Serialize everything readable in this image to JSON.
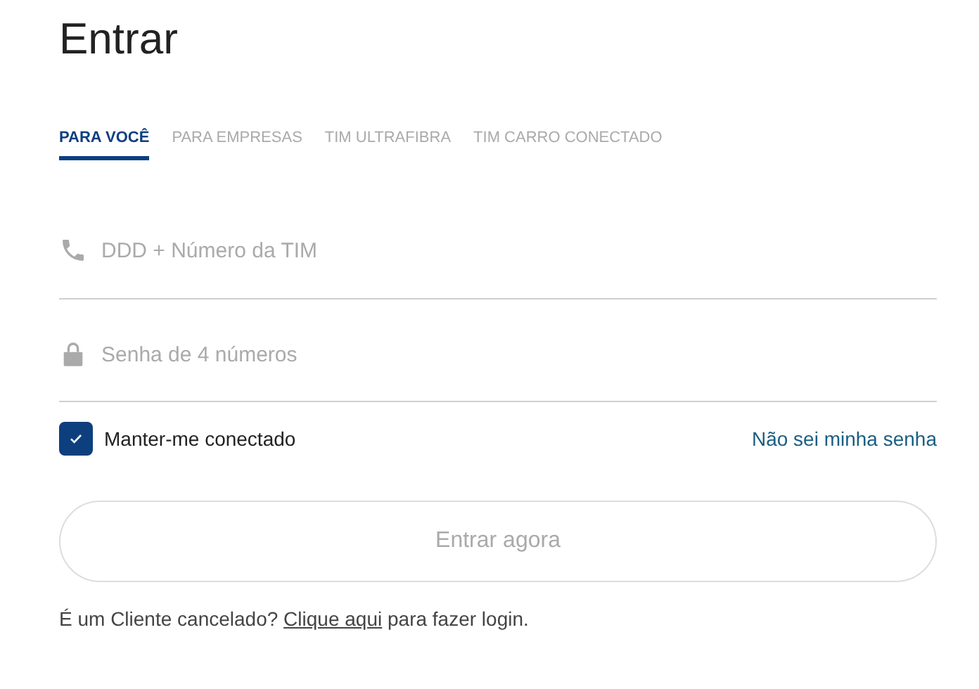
{
  "title": "Entrar",
  "tabs": [
    {
      "label": "PARA VOCÊ",
      "selected": true
    },
    {
      "label": "PARA EMPRESAS",
      "selected": false
    },
    {
      "label": "TIM ULTRAFIBRA",
      "selected": false
    },
    {
      "label": "TIM CARRO CONECTADO",
      "selected": false
    }
  ],
  "fields": [
    {
      "kind": "phone",
      "placeholder": "DDD + Número da TIM"
    },
    {
      "kind": "password",
      "placeholder": "Senha de 4 números"
    }
  ],
  "remember": {
    "label": "Manter-me conectado",
    "checked": true
  },
  "forgot_link": "Não sei minha senha",
  "submit": {
    "label": "Entrar agora",
    "disabled": true
  },
  "footer": {
    "before": "É um Cliente cancelado? ",
    "link": "Clique aqui",
    "after": " para fazer login."
  }
}
